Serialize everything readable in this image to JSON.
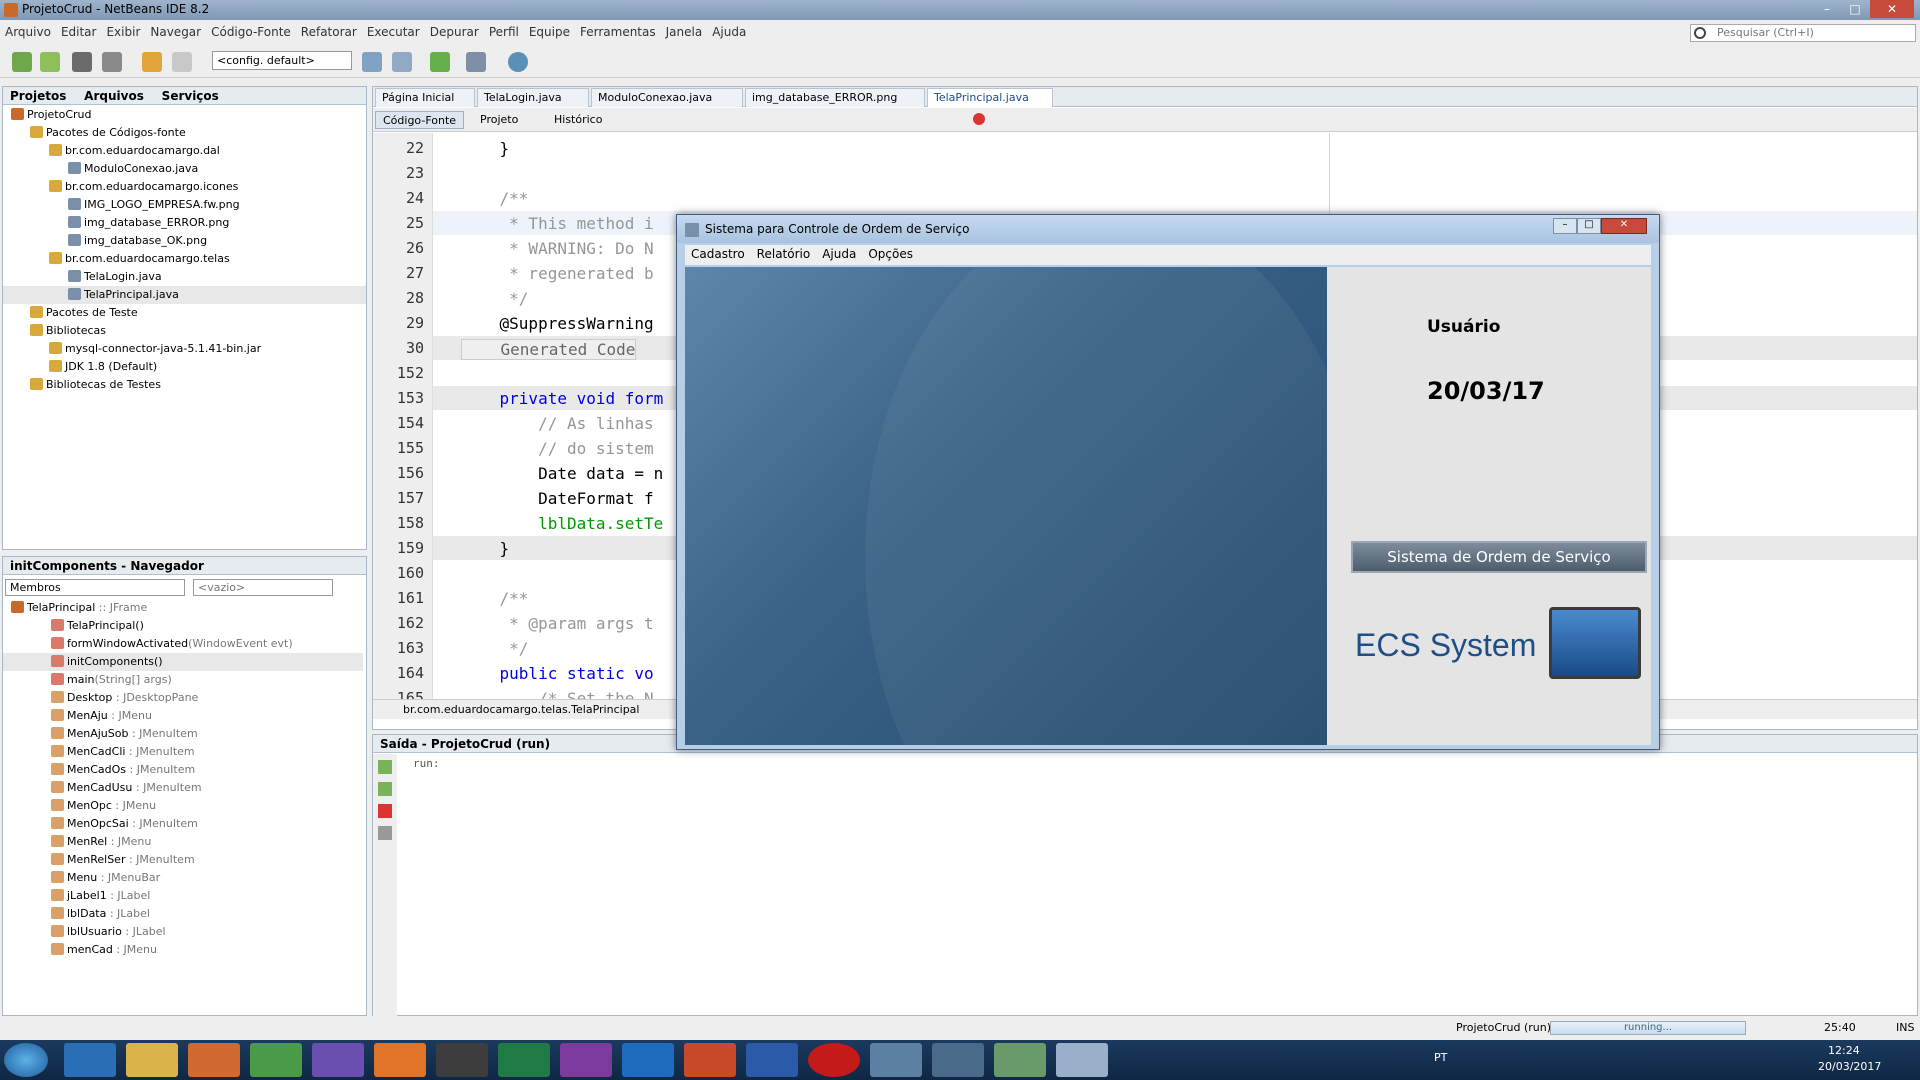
{
  "window": {
    "title": "ProjetoCrud - NetBeans IDE 8.2"
  },
  "menu": [
    "Arquivo",
    "Editar",
    "Exibir",
    "Navegar",
    "Código-Fonte",
    "Refatorar",
    "Executar",
    "Depurar",
    "Perfil",
    "Equipe",
    "Ferramentas",
    "Janela",
    "Ajuda"
  ],
  "search": {
    "placeholder": "Pesquisar (Ctrl+I)"
  },
  "toolbar": {
    "config": "<config. default>"
  },
  "projects": {
    "tabs": [
      "Projetos",
      "Arquivos",
      "Serviços"
    ],
    "tree": [
      {
        "label": "ProjetoCrud",
        "depth": 0
      },
      {
        "label": "Pacotes de Códigos-fonte",
        "depth": 1
      },
      {
        "label": "br.com.eduardocamargo.dal",
        "depth": 2
      },
      {
        "label": "ModuloConexao.java",
        "depth": 3
      },
      {
        "label": "br.com.eduardocamargo.icones",
        "depth": 2
      },
      {
        "label": "IMG_LOGO_EMPRESA.fw.png",
        "depth": 3
      },
      {
        "label": "img_database_ERROR.png",
        "depth": 3
      },
      {
        "label": "img_database_OK.png",
        "depth": 3
      },
      {
        "label": "br.com.eduardocamargo.telas",
        "depth": 2
      },
      {
        "label": "TelaLogin.java",
        "depth": 3
      },
      {
        "label": "TelaPrincipal.java",
        "depth": 3
      },
      {
        "label": "Pacotes de Teste",
        "depth": 1
      },
      {
        "label": "Bibliotecas",
        "depth": 1
      },
      {
        "label": "mysql-connector-java-5.1.41-bin.jar",
        "depth": 2
      },
      {
        "label": "JDK 1.8 (Default)",
        "depth": 2
      },
      {
        "label": "Bibliotecas de Testes",
        "depth": 1
      }
    ]
  },
  "navigator": {
    "title": "initComponents - Navegador",
    "filter": "Membros",
    "empty": "<vazio>",
    "items": [
      {
        "name": "TelaPrincipal",
        "type": " :: JFrame",
        "depth": 0
      },
      {
        "name": "TelaPrincipal()",
        "type": "",
        "depth": 1
      },
      {
        "name": "formWindowActivated",
        "type": "(WindowEvent evt)",
        "depth": 1
      },
      {
        "name": "initComponents()",
        "type": "",
        "depth": 1
      },
      {
        "name": "main",
        "type": "(String[] args)",
        "depth": 1
      },
      {
        "name": "Desktop",
        "type": " : JDesktopPane",
        "depth": 1
      },
      {
        "name": "MenAju",
        "type": " : JMenu",
        "depth": 1
      },
      {
        "name": "MenAjuSob",
        "type": " : JMenuItem",
        "depth": 1
      },
      {
        "name": "MenCadCli",
        "type": " : JMenuItem",
        "depth": 1
      },
      {
        "name": "MenCadOs",
        "type": " : JMenuItem",
        "depth": 1
      },
      {
        "name": "MenCadUsu",
        "type": " : JMenuItem",
        "depth": 1
      },
      {
        "name": "MenOpc",
        "type": " : JMenu",
        "depth": 1
      },
      {
        "name": "MenOpcSai",
        "type": " : JMenuItem",
        "depth": 1
      },
      {
        "name": "MenRel",
        "type": " : JMenu",
        "depth": 1
      },
      {
        "name": "MenRelSer",
        "type": " : JMenuItem",
        "depth": 1
      },
      {
        "name": "Menu",
        "type": " : JMenuBar",
        "depth": 1
      },
      {
        "name": "jLabel1",
        "type": " : JLabel",
        "depth": 1
      },
      {
        "name": "lblData",
        "type": " : JLabel",
        "depth": 1
      },
      {
        "name": "lblUsuario",
        "type": " : JLabel",
        "depth": 1
      },
      {
        "name": "menCad",
        "type": " : JMenu",
        "depth": 1
      }
    ]
  },
  "editor": {
    "tabs": [
      "Página Inicial",
      "TelaLogin.java",
      "ModuloConexao.java",
      "img_database_ERROR.png",
      "TelaPrincipal.java"
    ],
    "views": [
      "Código-Fonte",
      "Projeto",
      "Histórico"
    ],
    "lines": [
      {
        "n": "22",
        "code": "    }",
        "cls": ""
      },
      {
        "n": "23",
        "code": "",
        "cls": ""
      },
      {
        "n": "24",
        "code": "    /**",
        "cls": "cm"
      },
      {
        "n": "25",
        "code": "     * This method i",
        "cls": "cm"
      },
      {
        "n": "26",
        "code": "     * WARNING: Do N",
        "cls": "cm"
      },
      {
        "n": "27",
        "code": "     * regenerated b",
        "cls": "cm"
      },
      {
        "n": "28",
        "code": "     */",
        "cls": "cm"
      },
      {
        "n": "29",
        "code": "    @SuppressWarning",
        "cls": ""
      },
      {
        "n": "30",
        "code": "    Generated Code",
        "cls": "gen"
      },
      {
        "n": "152",
        "code": "",
        "cls": ""
      },
      {
        "n": "153",
        "code": "    private void form",
        "cls": "kw"
      },
      {
        "n": "154",
        "code": "        // As linhas",
        "cls": "cm"
      },
      {
        "n": "155",
        "code": "        // do sistem",
        "cls": "cm"
      },
      {
        "n": "156",
        "code": "        Date data = n",
        "cls": ""
      },
      {
        "n": "157",
        "code": "        DateFormat f",
        "cls": ""
      },
      {
        "n": "158",
        "code": "        lblData.setTe",
        "cls": "fld"
      },
      {
        "n": "159",
        "code": "    }",
        "cls": ""
      },
      {
        "n": "160",
        "code": "",
        "cls": ""
      },
      {
        "n": "161",
        "code": "    /**",
        "cls": "cm"
      },
      {
        "n": "162",
        "code": "     * @param args t",
        "cls": "cm"
      },
      {
        "n": "163",
        "code": "     */",
        "cls": "cm"
      },
      {
        "n": "164",
        "code": "    public static vo",
        "cls": "kw"
      },
      {
        "n": "165",
        "code": "        /* Set the N",
        "cls": "cm"
      }
    ],
    "breadcrumb": "br.com.eduardocamargo.telas.TelaPrincipal"
  },
  "output": {
    "title": "Saída - ProjetoCrud (run)",
    "text": "run:"
  },
  "status": {
    "project": "ProjetoCrud (run)",
    "progress": "running...",
    "position": "25:40",
    "mode": "INS"
  },
  "dialog": {
    "title": "Sistema para Controle de Ordem de Serviço",
    "menu": [
      "Cadastro",
      "Relatório",
      "Ajuda",
      "Opções"
    ],
    "user": "Usuário",
    "date": "20/03/17",
    "button": "Sistema de Ordem de Serviço",
    "logo": "ECS System"
  },
  "taskbar": {
    "lang": "PT",
    "time": "12:24",
    "date": "20/03/2017"
  },
  "colors": {
    "accent": "#1f4f86",
    "desktop": "#3a6387"
  }
}
